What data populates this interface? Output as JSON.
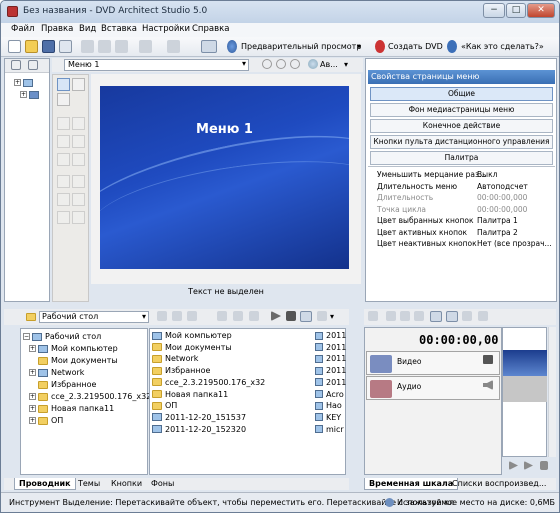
{
  "window": {
    "title": "Без названия - DVD Architect Studio 5.0",
    "btn_min": "−",
    "btn_max": "□",
    "btn_close": "✕"
  },
  "menubar": [
    "Файл",
    "Правка",
    "Вид",
    "Вставка",
    "Настройки",
    "Справка"
  ],
  "toolbar": {
    "preview": "Предварительный просмотр",
    "create_dvd": "Создать DVD",
    "howto": "«Как это сделать?»"
  },
  "left_tree": {
    "items": [
      "+",
      "+"
    ]
  },
  "editor": {
    "menu_select": "Меню 1",
    "text_select": "Ав...",
    "menu_title": "Меню 1",
    "status": "Текст не выделен"
  },
  "properties": {
    "header": "Свойства страницы меню",
    "buttons": [
      "Общие",
      "Фон медиастраницы меню",
      "Конечное действие",
      "Кнопки пульта дистанционного управления",
      "Палитра"
    ],
    "rows": [
      {
        "k": "Уменьшить мерцание раз...",
        "v": "Выкл",
        "dis": false
      },
      {
        "k": "Длительность меню",
        "v": "Автоподсчет",
        "dis": false
      },
      {
        "k": "Длительность",
        "v": "00:00:00,000",
        "dis": true
      },
      {
        "k": "Точка цикла",
        "v": "00:00:00,000",
        "dis": true
      },
      {
        "k": "Цвет выбранных кнопок",
        "v": "Палитра 1",
        "dis": false
      },
      {
        "k": "Цвет активных кнопок",
        "v": "Палитра 2",
        "dis": false
      },
      {
        "k": "Цвет неактивных кнопок",
        "v": "Нет (все прозрач...",
        "dis": false
      }
    ]
  },
  "explorer": {
    "path": "Рабочий стол",
    "tree": [
      "Рабочий стол",
      "Мой компьютер",
      "Мои документы",
      "Network",
      "Избранное",
      "cce_2.3.219500.176_x32",
      "Новая папка11",
      "ОП"
    ],
    "files": [
      "Мой компьютер",
      "Мои документы",
      "Network",
      "Избранное",
      "cce_2.3.219500.176_x32",
      "Новая папка11",
      "ОП",
      "2011-12-20_151537",
      "2011-12-20_152320"
    ],
    "files_col2": [
      "2011",
      "2011",
      "2011",
      "2011",
      "2011",
      "Acro",
      "Hao",
      "KEY",
      "micr"
    ],
    "tabs": [
      "Проводник",
      "Темы",
      "Кнопки",
      "Фоны"
    ]
  },
  "timeline": {
    "time": "00:00:00,00",
    "tracks": [
      "Видео",
      "Аудио"
    ],
    "tabs": [
      "Временная шкала",
      "Списки воспроизвед..."
    ]
  },
  "statusbar": {
    "text": "Инструмент Выделение: Перетаскивайте объект, чтобы переместить его. Перетаскивайте с зажатой кл",
    "disk": "Используемое место на диске: 0,6МБ"
  }
}
